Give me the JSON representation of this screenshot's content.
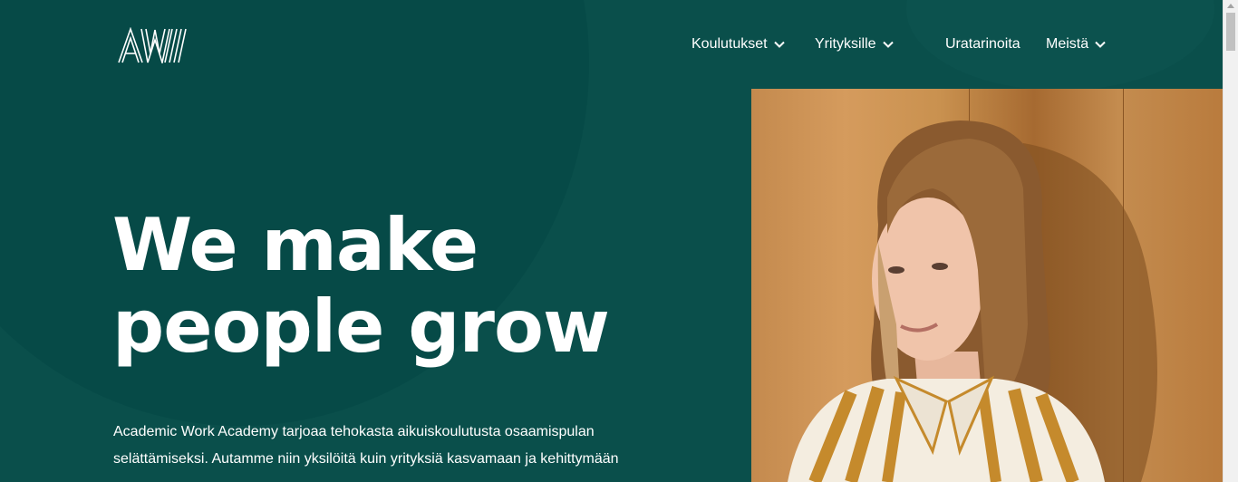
{
  "brand": {
    "logo_text": "AW",
    "colors": {
      "background": "#0a4f4b",
      "text": "#ffffff"
    }
  },
  "nav": {
    "items": [
      {
        "label": "Koulutukset",
        "has_dropdown": true
      },
      {
        "label": "Yrityksille",
        "has_dropdown": true
      },
      {
        "label": "Uratarinoita",
        "has_dropdown": false
      },
      {
        "label": "Meistä",
        "has_dropdown": true
      }
    ]
  },
  "hero": {
    "headline_line1": "We make",
    "headline_line2": "people grow",
    "intro": "Academic Work Academy tarjoaa tehokasta aikuiskoulutusta osaamispulan selättämiseksi. Autamme niin yksilöitä kuin yrityksiä kasvamaan ja kehittymään"
  }
}
